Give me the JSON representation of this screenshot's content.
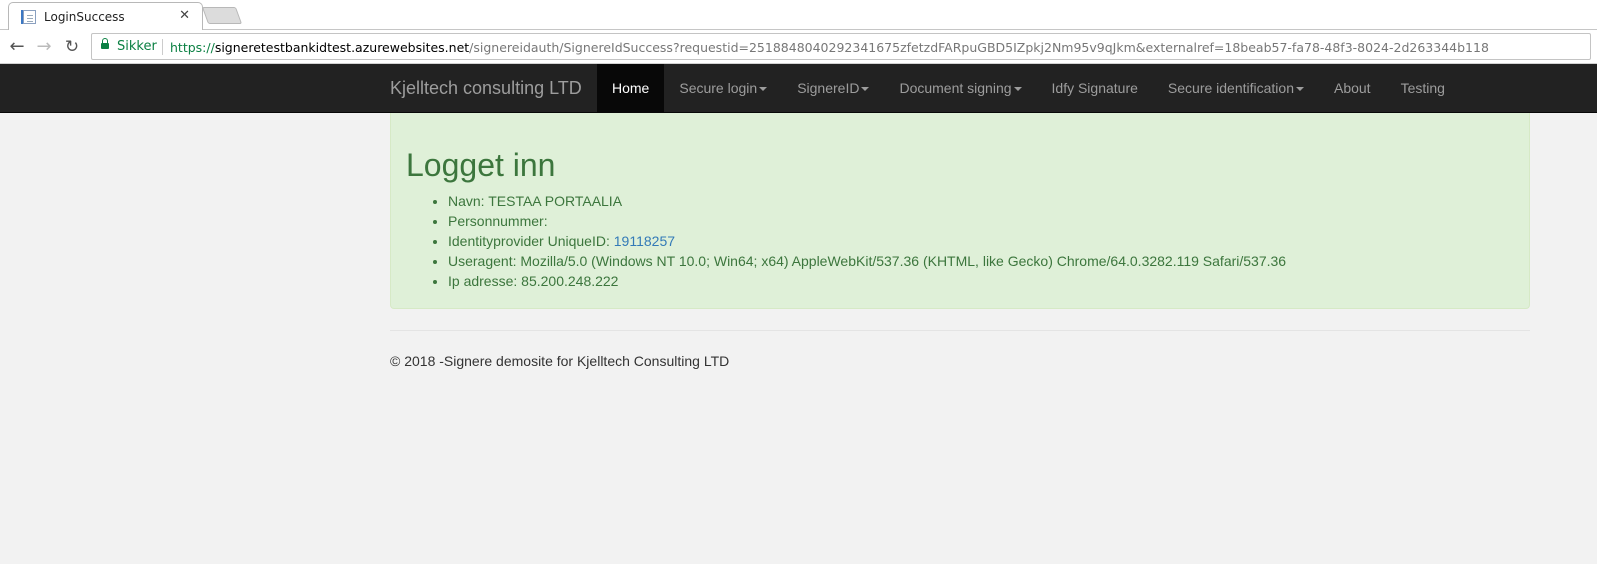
{
  "browser": {
    "tab_title": "LoginSuccess",
    "tab_close": "✕",
    "secure_label": "Sikker",
    "url_scheme": "https://",
    "url_host": "signeretestbankidtest.azurewebsites.net",
    "url_path": "/signereidauth/SignereIdSuccess?requestid=2518848040292341675zfetzdFARpuGBD5IZpkj2Nm95v9qJkm&externalref=18beab57-fa78-48f3-8024-2d263344b118"
  },
  "navbar": {
    "brand": "Kjelltech consulting LTD",
    "items": [
      {
        "label": "Home",
        "active": true,
        "dropdown": false
      },
      {
        "label": "Secure login",
        "active": false,
        "dropdown": true
      },
      {
        "label": "SignereID",
        "active": false,
        "dropdown": true
      },
      {
        "label": "Document signing",
        "active": false,
        "dropdown": true
      },
      {
        "label": "Idfy Signature",
        "active": false,
        "dropdown": false
      },
      {
        "label": "Secure identification",
        "active": false,
        "dropdown": true
      },
      {
        "label": "About",
        "active": false,
        "dropdown": false
      },
      {
        "label": "Testing",
        "active": false,
        "dropdown": false
      }
    ]
  },
  "main": {
    "heading": "Logget inn",
    "name_label": "Navn: ",
    "name_value": "TESTAA PORTAALIA",
    "personnummer_label": "Personnummer:",
    "uid_label": "Identityprovider UniqueID: ",
    "uid_value": "19118257",
    "useragent_label": "Useragent: ",
    "useragent_value": "Mozilla/5.0 (Windows NT 10.0; Win64; x64) AppleWebKit/537.36 (KHTML, like Gecko) Chrome/64.0.3282.119 Safari/537.36",
    "ip_label": "Ip adresse: ",
    "ip_value": "85.200.248.222"
  },
  "footer": {
    "text": "© 2018 -Signere demosite for Kjelltech Consulting LTD"
  },
  "colors": {
    "navbar_bg": "#222222",
    "alert_bg": "#dff0d8",
    "alert_text": "#3c763d",
    "link": "#337ab7",
    "secure_green": "#0b8043"
  }
}
